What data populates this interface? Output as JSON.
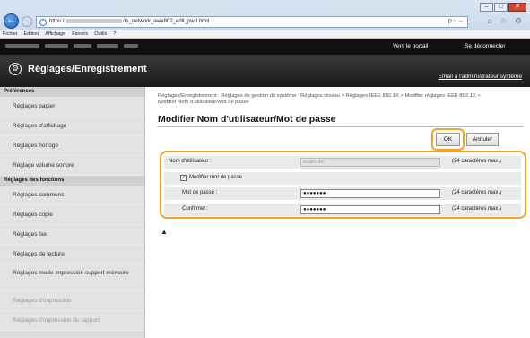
{
  "browser": {
    "url_prefix": "https://",
    "url_suffix": "/rs_network_ieee802_edit_pwd.html",
    "search_control": "ρ - →",
    "toolbar_icons": "⌂ ☆ ⚙",
    "window_controls": [
      "–",
      "□",
      "✕"
    ],
    "menu": [
      "Fichier",
      "Edition",
      "Affichage",
      "Favoris",
      "Outils",
      "?"
    ]
  },
  "header": {
    "portal_link": "Vers le portail",
    "logout_link": "Se déconnecter",
    "app_title": "Réglages/Enregistrement",
    "admin_email_link": "Email à l'administrateur système"
  },
  "sidebar": {
    "sections": [
      {
        "title": "Préférences",
        "items": [
          "Réglages papier",
          "Réglages d'affichage",
          "Réglages horloge",
          "Réglage volume sonore"
        ]
      },
      {
        "title": "Réglages des fonctions",
        "items": [
          "Réglages communs",
          "Réglages copie",
          "Réglages fax",
          "Réglages de lecture",
          "Réglages mode Impression support mémoire",
          "Réglages d'impression",
          "Réglages d'impression du rapport"
        ]
      }
    ]
  },
  "main": {
    "breadcrumb": "Réglages/Enregistrement : Réglages de gestion du système : Réglages réseau > Réglages IEEE 802.1X > Modifier réglages IEEE 802.1X > Modifier Nom d'utilisateur/Mot de passe",
    "page_title": "Modifier Nom d'utilisateur/Mot de passe",
    "ok_label": "OK",
    "cancel_label": "Annuler",
    "form": {
      "username_label": "Nom d'utilisateur :",
      "username_value": "example",
      "username_hint": "(24 caractères max.)",
      "change_password_label": "Modifier mot de passe",
      "change_password_checked": "✓",
      "password_label": "Mot de passe :",
      "password_value": "●●●●●●●",
      "password_hint": "(24 caractères max.)",
      "confirm_label": "Confirmer :",
      "confirm_value": "●●●●●●●",
      "confirm_hint": "(24 caractères max.)"
    },
    "top_anchor": "▲"
  }
}
